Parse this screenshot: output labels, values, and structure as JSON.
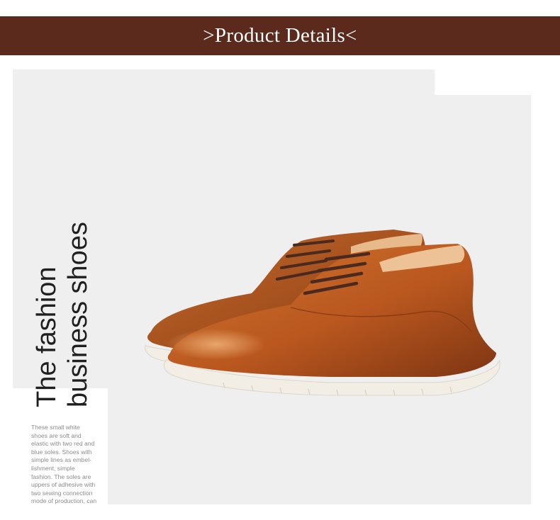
{
  "header": {
    "title": ">Product Details<"
  },
  "headline": {
    "line1": "The fashion",
    "line2": "business shoes"
  },
  "description": {
    "lines": [
      "These small white",
      "shoes are soft and",
      "elastic with two red and",
      "blue soles. Shoes with",
      "simple lines as embel-",
      "lishment, simple",
      "fashion. The soles are",
      "uppers of adhesive with",
      "two sewing connection",
      "mode of production, can"
    ]
  },
  "colors": {
    "header_bg": "#5b2a1c",
    "panel_bg": "#efefef",
    "leather": "#b9571f",
    "sole": "#f2eee6",
    "laces": "#4a2a1e"
  },
  "image": {
    "icon": "brown-leather-derby-shoes-image"
  }
}
